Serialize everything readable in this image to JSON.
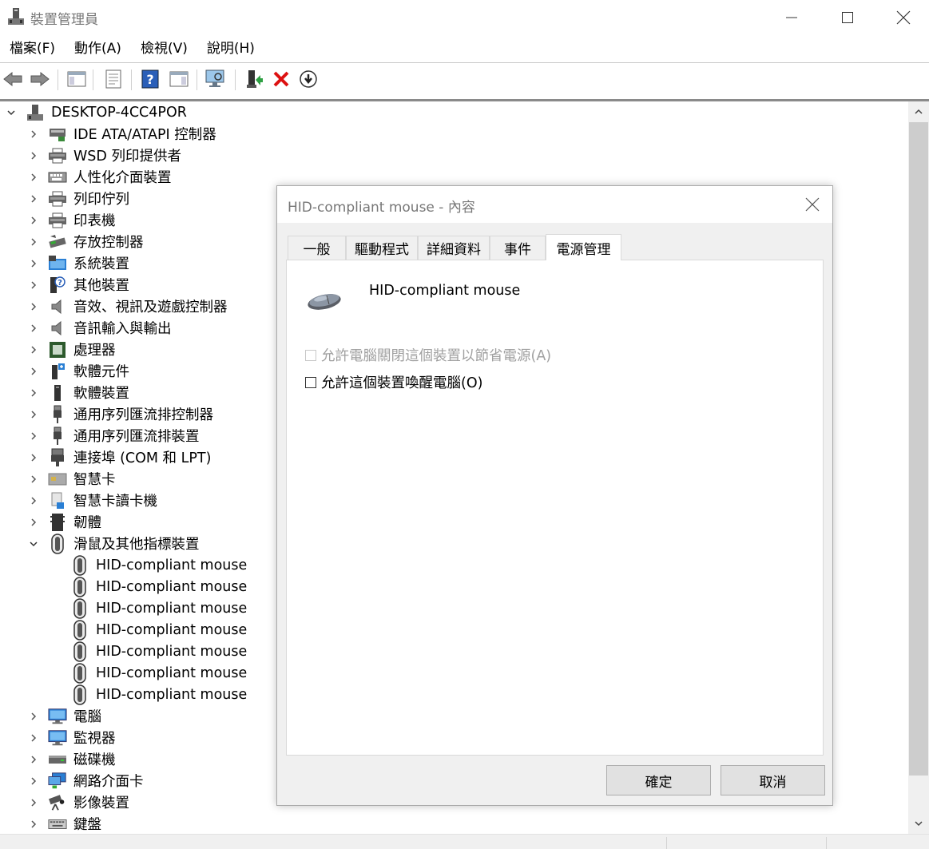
{
  "window": {
    "title": "裝置管理員"
  },
  "menu": [
    "檔案(F)",
    "動作(A)",
    "檢視(V)",
    "說明(H)"
  ],
  "tree": {
    "root": "DESKTOP-4CC4POR",
    "items": [
      {
        "label": "IDE ATA/ATAPI 控制器",
        "icon": "ide-controller-icon"
      },
      {
        "label": "WSD 列印提供者",
        "icon": "printer-icon"
      },
      {
        "label": "人性化介面裝置",
        "icon": "hid-icon"
      },
      {
        "label": "列印佇列",
        "icon": "printer-icon"
      },
      {
        "label": "印表機",
        "icon": "printer-icon"
      },
      {
        "label": "存放控制器",
        "icon": "storage-controller-icon"
      },
      {
        "label": "系統裝置",
        "icon": "system-device-icon"
      },
      {
        "label": "其他裝置",
        "icon": "unknown-device-icon"
      },
      {
        "label": "音效、視訊及遊戲控制器",
        "icon": "speaker-icon"
      },
      {
        "label": "音訊輸入與輸出",
        "icon": "speaker-icon"
      },
      {
        "label": "處理器",
        "icon": "processor-icon"
      },
      {
        "label": "軟體元件",
        "icon": "software-component-icon"
      },
      {
        "label": "軟體裝置",
        "icon": "software-device-icon"
      },
      {
        "label": "通用序列匯流排控制器",
        "icon": "usb-icon"
      },
      {
        "label": "通用序列匯流排裝置",
        "icon": "usb-icon"
      },
      {
        "label": "連接埠 (COM 和 LPT)",
        "icon": "port-icon"
      },
      {
        "label": "智慧卡",
        "icon": "smart-card-icon"
      },
      {
        "label": "智慧卡讀卡機",
        "icon": "card-reader-icon"
      },
      {
        "label": "韌體",
        "icon": "firmware-icon"
      },
      {
        "label": "滑鼠及其他指標裝置",
        "icon": "mouse-icon",
        "expanded": true,
        "children": [
          "HID-compliant mouse",
          "HID-compliant mouse",
          "HID-compliant mouse",
          "HID-compliant mouse",
          "HID-compliant mouse",
          "HID-compliant mouse",
          "HID-compliant mouse"
        ]
      },
      {
        "label": "電腦",
        "icon": "monitor-icon"
      },
      {
        "label": "監視器",
        "icon": "monitor-icon"
      },
      {
        "label": "磁碟機",
        "icon": "disk-drive-icon"
      },
      {
        "label": "網路介面卡",
        "icon": "network-adapter-icon"
      },
      {
        "label": "影像裝置",
        "icon": "camera-icon"
      },
      {
        "label": "鍵盤",
        "icon": "keyboard-icon"
      }
    ]
  },
  "dialog": {
    "title": "HID-compliant mouse - 內容",
    "tabs": [
      "一般",
      "驅動程式",
      "詳細資料",
      "事件",
      "電源管理"
    ],
    "active_tab": 4,
    "device_name": "HID-compliant mouse",
    "option_power_off": "允許電腦關閉這個裝置以節省電源(A)",
    "option_wake": "允許這個裝置喚醒電腦(O)",
    "ok_label": "確定",
    "cancel_label": "取消"
  }
}
